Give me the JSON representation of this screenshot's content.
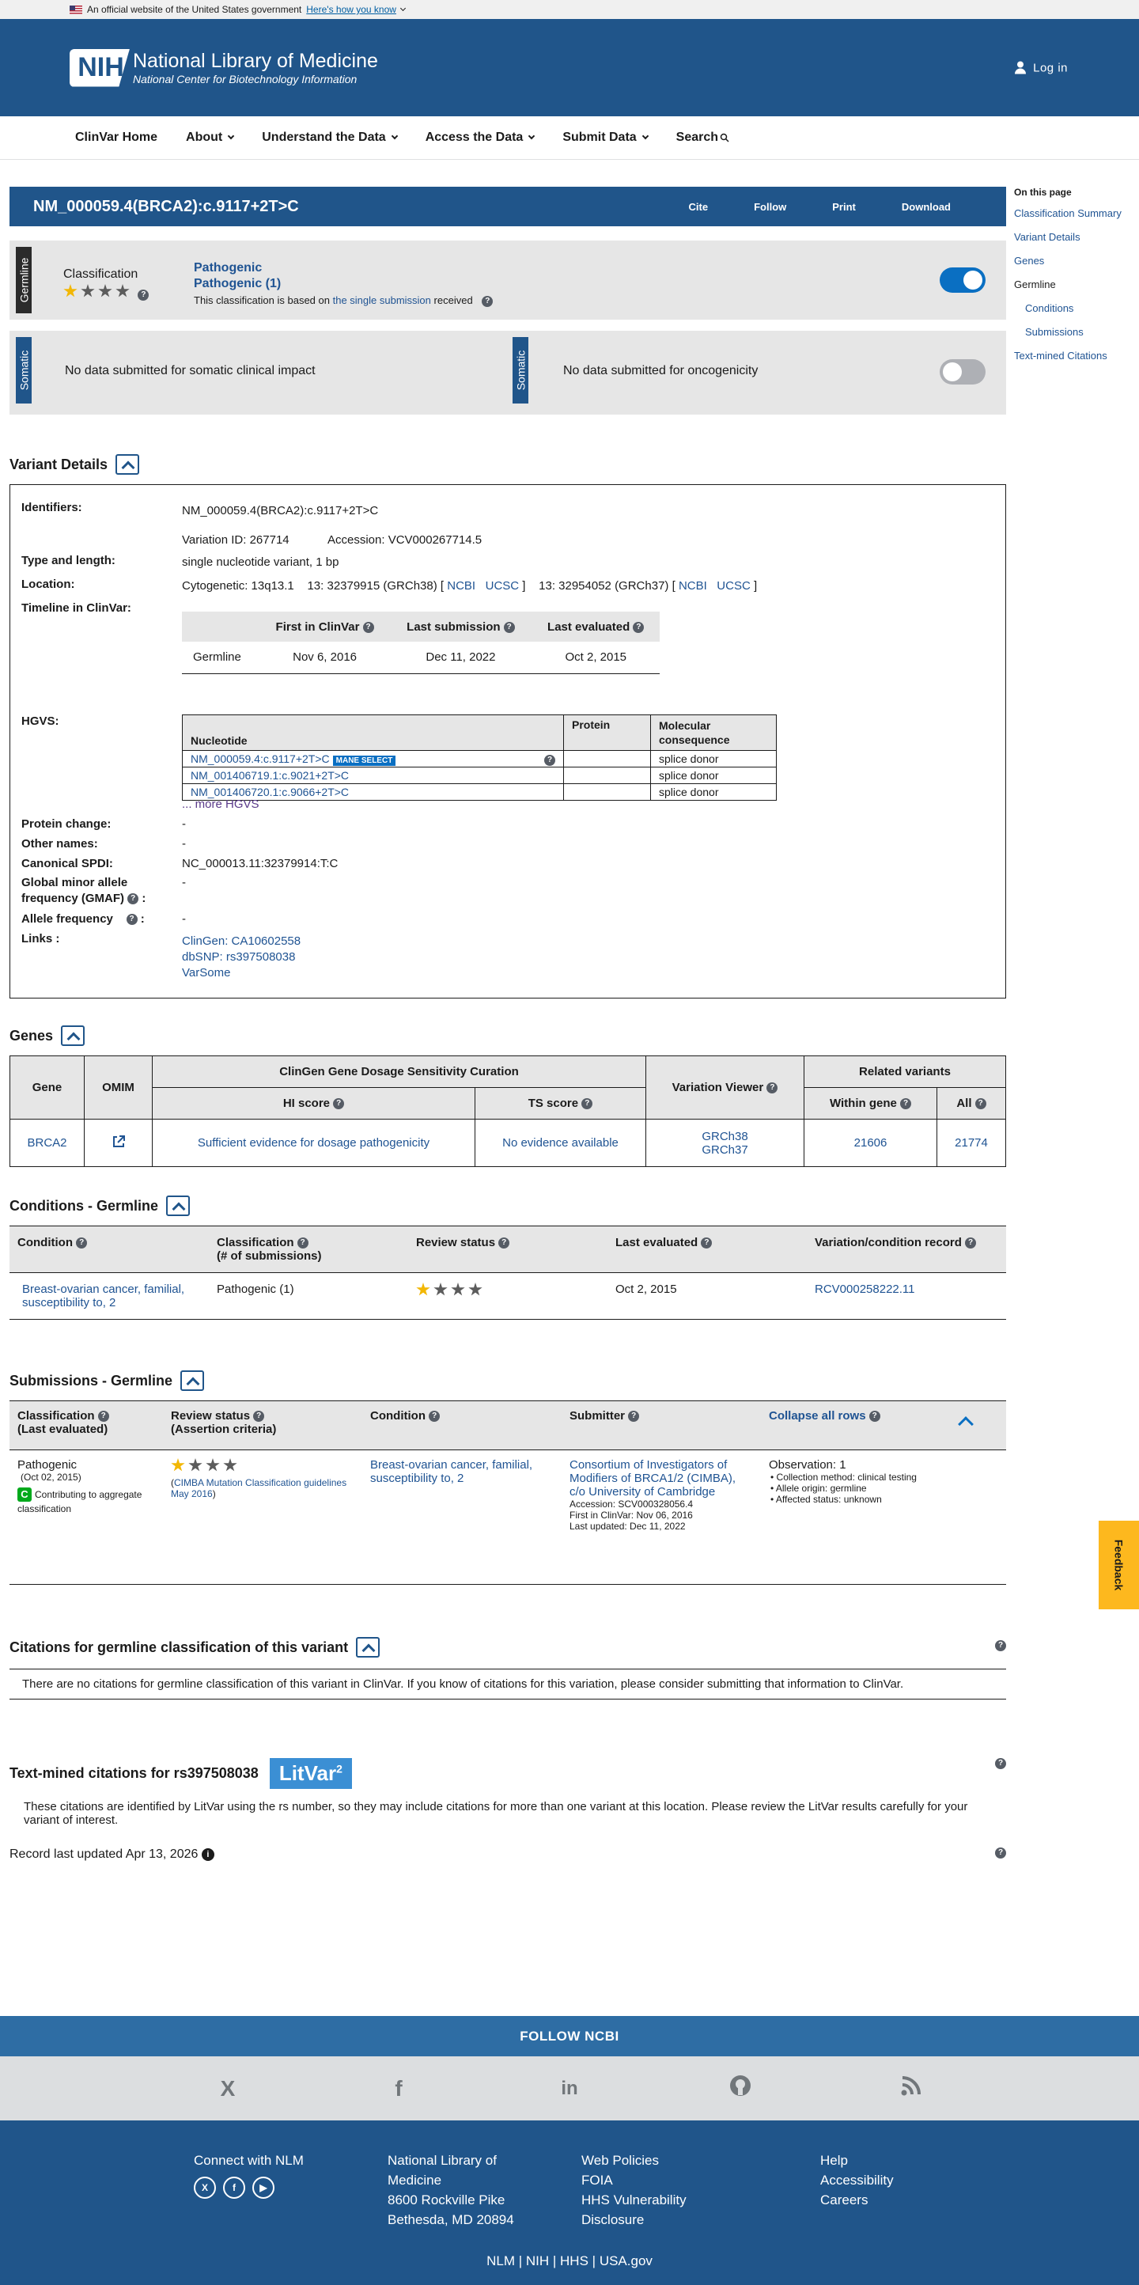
{
  "gov_banner": {
    "text": "An official website of the United States government",
    "link": "Here's how you know"
  },
  "header": {
    "logo": "NIH",
    "title": "National Library of Medicine",
    "subtitle": "National Center for Biotechnology Information",
    "login": "Log in"
  },
  "nav": {
    "items": [
      "ClinVar Home",
      "About",
      "Understand the Data",
      "Access the Data",
      "Submit Data",
      "Search"
    ]
  },
  "sidebar": {
    "heading": "On this page",
    "items": [
      "Classification Summary",
      "Variant Details",
      "Genes",
      "Germline",
      "Conditions",
      "Submissions",
      "Text-mined Citations"
    ]
  },
  "variant": {
    "title": "NM_000059.4(BRCA2):c.9117+2T>C",
    "actions": [
      "Cite",
      "Follow",
      "Print",
      "Download"
    ]
  },
  "germline_panel": {
    "tag": "Germline",
    "classification_label": "Classification",
    "classification": "Pathogenic",
    "classification_count": "Pathogenic (1)",
    "basis_prefix": "This classification is based on",
    "basis_link": "the single submission",
    "basis_suffix": "received",
    "stars_gold": 1,
    "toggle_on": true
  },
  "somatic_panel": {
    "tag": "Somatic",
    "clinical": "No data submitted for somatic clinical impact",
    "oncogenicity": "No data submitted for oncogenicity",
    "toggle_on": false
  },
  "variant_details": {
    "heading": "Variant Details",
    "identifiers_label": "Identifiers:",
    "identifier": "NM_000059.4(BRCA2):c.9117+2T>C",
    "variation_id": "Variation ID: 267714",
    "accession": "Accession: VCV000267714.5",
    "type_label": "Type and length:",
    "type": "single nucleotide variant, 1 bp",
    "location_label": "Location:",
    "cytogenetic": "Cytogenetic: 13q13.1",
    "grch38": "13: 32379915 (GRCh38) [",
    "grch37": "13: 32954052 (GRCh37) [",
    "ncbi": "NCBI",
    "ucsc": "UCSC",
    "close_bracket": "]",
    "timeline_label": "Timeline in ClinVar:",
    "timeline_headers": [
      "First in ClinVar",
      "Last submission",
      "Last evaluated"
    ],
    "timeline_row": [
      "Germline",
      "Nov 6, 2016",
      "Dec 11, 2022",
      "Oct 2, 2015"
    ],
    "hgvs_label": "HGVS:",
    "hgvs_headers": [
      "Nucleotide",
      "Protein",
      "Molecular consequence"
    ],
    "hgvs_rows": [
      {
        "nucleotide": "NM_000059.4:c.9117+2T>C",
        "badge": "MANE SELECT",
        "protein": "",
        "consequence": "splice donor"
      },
      {
        "nucleotide": "NM_001406719.1:c.9021+2T>C",
        "badge": "",
        "protein": "",
        "consequence": "splice donor"
      },
      {
        "nucleotide": "NM_001406720.1:c.9066+2T>C",
        "badge": "",
        "protein": "",
        "consequence": "splice donor"
      }
    ],
    "more_hgvs": "... more HGVS",
    "protein_change_label": "Protein change:",
    "protein_change": "-",
    "other_names_label": "Other names:",
    "other_names": "-",
    "spdi_label": "Canonical SPDI:",
    "spdi": "NC_000013.11:32379914:T:C",
    "gmaf_label_1": "Global minor allele",
    "gmaf_label_2": "frequency (GMAF)",
    "gmaf_colon": ":",
    "gmaf": "-",
    "allele_freq_label": "Allele frequency",
    "allele_freq": "-",
    "links_label": "Links :",
    "links": [
      "ClinGen: CA10602558",
      "dbSNP: rs397508038",
      "VarSome"
    ]
  },
  "genes": {
    "heading": "Genes",
    "headers": {
      "gene": "Gene",
      "omim": "OMIM",
      "clingen": "ClinGen Gene Dosage Sensitivity Curation",
      "hi": "HI score",
      "ts": "TS score",
      "viewer": "Variation Viewer",
      "related": "Related variants",
      "within": "Within gene",
      "all": "All"
    },
    "row": {
      "gene": "BRCA2",
      "hi": "Sufficient evidence for dosage pathogenicity",
      "ts": "No evidence available",
      "grch38": "GRCh38",
      "grch37": "GRCh37",
      "within": "21606",
      "all": "21774"
    }
  },
  "conditions": {
    "heading": "Conditions - Germline",
    "headers": [
      "Condition",
      "Classification",
      "(# of submissions)",
      "Review status",
      "Last evaluated",
      "Variation/condition record"
    ],
    "row": {
      "condition": "Breast-ovarian cancer, familial, susceptibility to, 2",
      "classification": "Pathogenic (1)",
      "stars_gold": 1,
      "last_evaluated": "Oct 2, 2015",
      "record": "RCV000258222.11"
    }
  },
  "submissions": {
    "heading": "Submissions - Germline",
    "headers": {
      "classification": "Classification",
      "last_eval": "(Last evaluated)",
      "review": "Review status",
      "criteria": "(Assertion criteria)",
      "condition": "Condition",
      "submitter": "Submitter",
      "collapse": "Collapse all rows"
    },
    "row": {
      "classification": "Pathogenic",
      "date": "(Oct 02, 2015)",
      "badge": "C",
      "contributing": "Contributing to aggregate classification",
      "stars_gold": 1,
      "criteria_link": "CIMBA Mutation Classification guidelines May 2016",
      "condition": "Breast-ovarian cancer, familial, susceptibility to, 2",
      "submitter": "Consortium of Investigators of Modifiers of BRCA1/2 (CIMBA), c/o University of Cambridge",
      "accession": "Accession: SCV000328056.4",
      "first_in": "First in ClinVar: Nov 06, 2016",
      "last_updated": "Last updated: Dec 11, 2022",
      "observation": "Observation: 1",
      "collection": "Collection method: clinical testing",
      "allele_origin": "Allele origin: germline",
      "affected": "Affected status: unknown"
    }
  },
  "citations": {
    "heading": "Citations for germline classification of this variant",
    "text": "There are no citations for germline classification of this variant in ClinVar. If you know of citations for this variation, please consider submitting that information to ClinVar."
  },
  "textmined": {
    "heading": "Text-mined citations for rs397508038",
    "litvar": "LitVar",
    "litvar_sup": "2",
    "text": "These citations are identified by LitVar using the rs number, so they may include citations for more than one variant at this location. Please review the LitVar results carefully for your variant of interest."
  },
  "record_updated": "Record last updated Apr 13, 2026",
  "feedback": "Feedback",
  "follow_ncbi": "FOLLOW NCBI",
  "footer": {
    "connect": "Connect with NLM",
    "address": [
      "National Library of",
      "Medicine",
      "8600 Rockville Pike",
      "Bethesda, MD 20894"
    ],
    "policies": [
      "Web Policies",
      "FOIA",
      "HHS Vulnerability",
      "Disclosure"
    ],
    "help": [
      "Help",
      "Accessibility",
      "Careers"
    ],
    "bottom": [
      "NLM",
      "NIH",
      "HHS",
      "USA.gov"
    ]
  }
}
